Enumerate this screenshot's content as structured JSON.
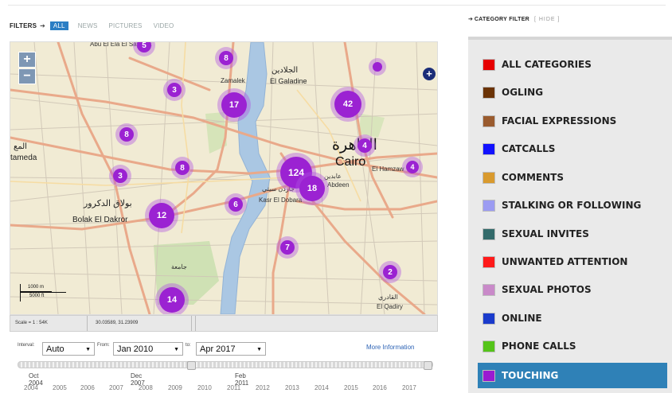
{
  "filters": {
    "label": "FILTERS",
    "arrow": "➔",
    "tabs": [
      {
        "label": "ALL",
        "active": true
      },
      {
        "label": "NEWS",
        "active": false
      },
      {
        "label": "PICTURES",
        "active": false
      },
      {
        "label": "VIDEO",
        "active": false
      }
    ]
  },
  "map": {
    "zoom_in": "+",
    "zoom_out": "−",
    "layer_switcher": "+",
    "labels": {
      "cairo_ar": "القاهرة",
      "cairo": "Cairo",
      "el_galadine": "El Galadine",
      "el_galadine_ar": "الجلادين",
      "zamalek": "Zamalek",
      "tameda": "tameda",
      "tameda_ar": "المع",
      "bolak": "Bolak El Dakror",
      "bolak_ar": "بولاق الدكرور",
      "kasr": "Kasr El Dobara",
      "kasr_ar": "جاردن سيتي",
      "el_hamzaw": "El Hamzaw",
      "el_qadiry": "El Qadiry",
      "el_qadiry_ar": "القادري",
      "jamaa": "جامعة",
      "abdeen": "عابدين",
      "abdeen_en": "Abdeen",
      "top": "Abu El Ela El Sayyida"
    },
    "clusters": [
      {
        "label": "5"
      },
      {
        "label": "8"
      },
      {
        "label": "3"
      },
      {
        "label": "17"
      },
      {
        "label": "42"
      },
      {
        "label": "8"
      },
      {
        "label": "4"
      },
      {
        "label": "3"
      },
      {
        "label": "8"
      },
      {
        "label": "124"
      },
      {
        "label": "18"
      },
      {
        "label": "4"
      },
      {
        "label": "12"
      },
      {
        "label": "6"
      },
      {
        "label": "7"
      },
      {
        "label": "2"
      },
      {
        "label": "14"
      },
      {
        "label": ""
      }
    ],
    "scale_m": "1000 m",
    "scale_ft": "5000 ft",
    "footer_scale": "Scale = 1 : 54K",
    "footer_coords": "30.03589, 31.23909"
  },
  "timeline": {
    "interval_label": "Interval:",
    "interval_value": "Auto",
    "from_label": "From:",
    "from_value": "Jan 2010",
    "to_label": "to:",
    "to_value": "Apr 2017",
    "more_info": "More Information",
    "marks": [
      {
        "text": "Oct\n2004"
      },
      {
        "text": "Dec\n2007"
      },
      {
        "text": "Feb\n2011"
      }
    ],
    "years": [
      "2004",
      "2005",
      "2006",
      "2007",
      "2008",
      "2009",
      "2010",
      "2011",
      "2012",
      "2013",
      "2014",
      "2015",
      "2016",
      "2017"
    ]
  },
  "category_filter": {
    "arrow": "➔",
    "title": "CATEGORY FILTER",
    "hide": "[ HIDE ]",
    "items": [
      {
        "label": "ALL CATEGORIES",
        "color": "#e60000",
        "active": false
      },
      {
        "label": "OGLING",
        "color": "#6b3306",
        "active": false
      },
      {
        "label": "FACIAL EXPRESSIONS",
        "color": "#9a5b2e",
        "active": false
      },
      {
        "label": "CATCALLS",
        "color": "#1212ff",
        "active": false
      },
      {
        "label": "COMMENTS",
        "color": "#d99a2e",
        "active": false
      },
      {
        "label": "STALKING OR FOLLOWING",
        "color": "#9c9cf2",
        "active": false
      },
      {
        "label": "SEXUAL INVITES",
        "color": "#336b6b",
        "active": false
      },
      {
        "label": "UNWANTED ATTENTION",
        "color": "#ff1a1a",
        "active": false
      },
      {
        "label": "SEXUAL PHOTOS",
        "color": "#c98ac9",
        "active": false
      },
      {
        "label": "ONLINE",
        "color": "#1a3bcc",
        "active": false
      },
      {
        "label": "PHONE CALLS",
        "color": "#55c41a",
        "active": false
      },
      {
        "label": "TOUCHING",
        "color": "#9a1ad1",
        "active": true
      }
    ]
  }
}
